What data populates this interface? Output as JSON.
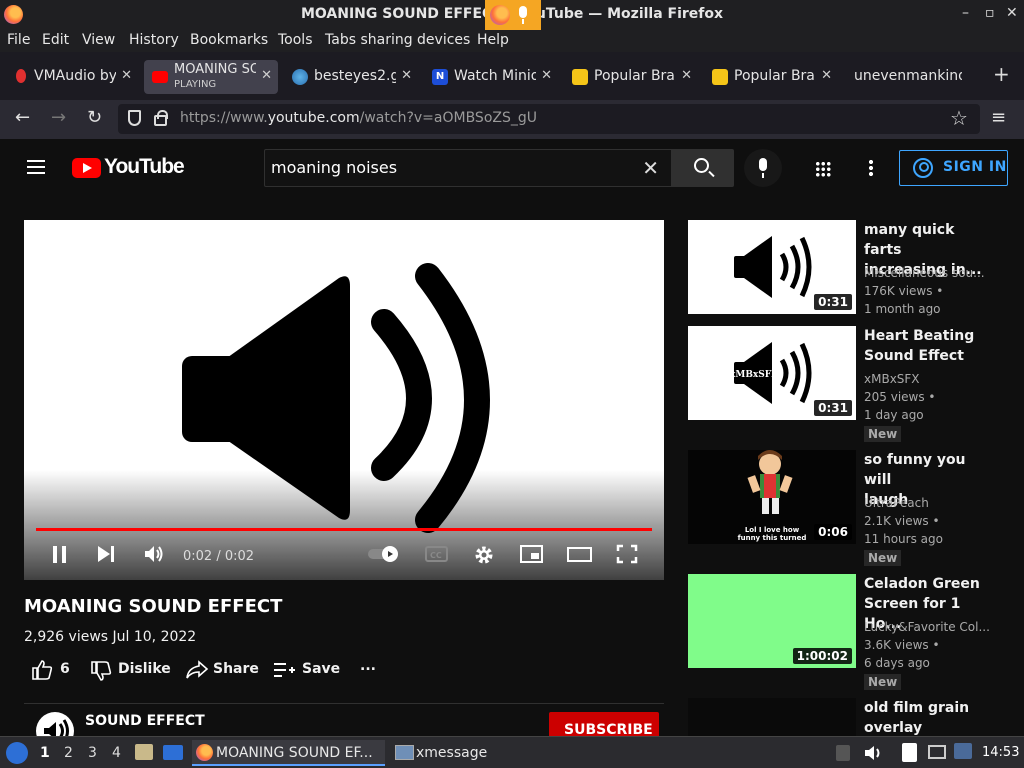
{
  "window": {
    "title": "MOANING SOUND EFFECT - YouTube — Mozilla Firefox"
  },
  "menu": [
    "File",
    "Edit",
    "View",
    "History",
    "Bookmarks",
    "Tools",
    "Tabs sharing devices",
    "Help"
  ],
  "tabs": [
    {
      "label": "VMAudio by",
      "favicon_color": "#e03030"
    },
    {
      "label": "MOANING SO",
      "sub": "PLAYING",
      "favicon_color": "#ff0000",
      "active": true
    },
    {
      "label": "besteyes2.g",
      "favicon_color": "#4a90d9"
    },
    {
      "label": "Watch Minio",
      "favicon_color": "#1d4ed8"
    },
    {
      "label": "Popular Bran",
      "favicon_color": "#f5c518"
    },
    {
      "label": "Popular Bran",
      "favicon_color": "#f5c518"
    },
    {
      "label": "unevenmankind",
      "favicon_color": ""
    }
  ],
  "address_bar": {
    "prefix": "https://www.",
    "domain": "youtube.com",
    "path": "/watch?v=aOMBSoZS_gU"
  },
  "youtube": {
    "logo_text": "YouTube",
    "search_value": "moaning noises",
    "sign_in": "SIGN IN"
  },
  "player": {
    "time": "0:02 / 0:02",
    "progress": 1.0
  },
  "video": {
    "title": "MOANING SOUND EFFECT",
    "meta": "2,926 views  Jul 10, 2022",
    "likes": "6",
    "dislike": "Dislike",
    "share": "Share",
    "save": "Save",
    "more": "..."
  },
  "channel": {
    "name": "SOUND EFFECT",
    "subscribe": "SUBSCRIBE"
  },
  "recommendations": [
    {
      "title_l1": "many quick farts",
      "title_l2": "increasing in...",
      "channel": "Miscellaneous sou...",
      "views": "176K views •",
      "age": "1 month ago",
      "duration": "0:31",
      "thumb": "speaker",
      "is_new": false
    },
    {
      "title_l1": "Heart Beating",
      "title_l2": "Sound Effect",
      "channel": "xMBxSFX",
      "views": "205 views •",
      "age": "1 day ago",
      "duration": "0:31",
      "thumb": "speaker-x",
      "thumb_text": "xMBxSFX",
      "is_new": true,
      "new_label": "New"
    },
    {
      "title_l1": "so funny you will",
      "title_l2": "laugh",
      "channel": "UltraPeach",
      "views": "2.1K views •",
      "age": "11 hours ago",
      "duration": "0:06",
      "thumb": "dark",
      "thumb_text_1": "Lol I love how",
      "thumb_text_2": "funny this turned",
      "is_new": true,
      "new_label": "New"
    },
    {
      "title_l1": "Celadon Green",
      "title_l2": "Screen for 1 Ho...",
      "channel": "Lucky&Favorite Col...",
      "views": "3.6K views •",
      "age": "6 days ago",
      "duration": "1:00:02",
      "thumb": "green",
      "thumb_color": "#80fc8a",
      "is_new": true,
      "new_label": "New"
    },
    {
      "title_l1": "old film grain",
      "title_l2": "overlay Video...",
      "thumb": "black"
    }
  ],
  "taskbar": {
    "workspaces": [
      "1",
      "2",
      "3",
      "4"
    ],
    "tasks": [
      "MOANING SOUND EF...",
      "xmessage"
    ],
    "clock": "14:53"
  }
}
